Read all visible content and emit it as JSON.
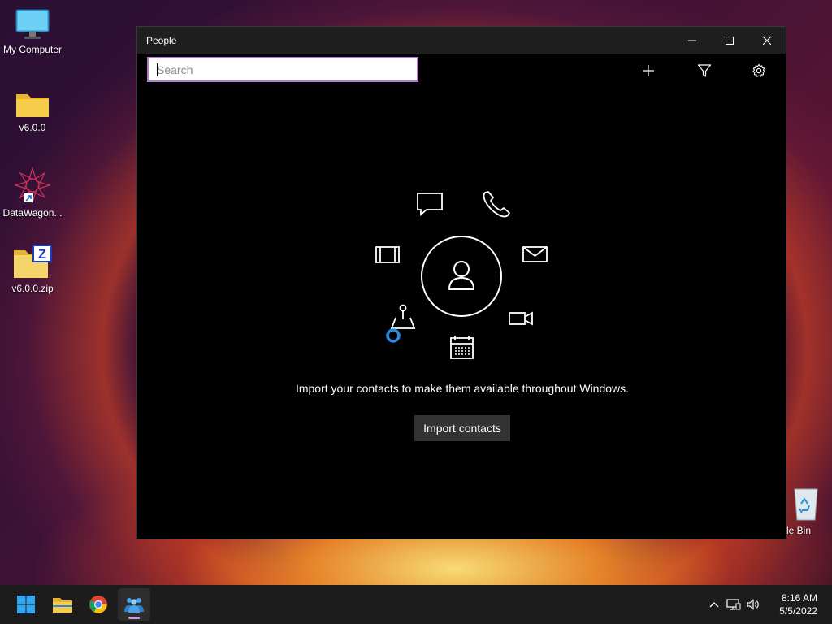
{
  "desktop": {
    "icons": [
      {
        "label": "My Computer"
      },
      {
        "label": "v6.0.0"
      },
      {
        "label": "DataWagon..."
      },
      {
        "label": "v6.0.0.zip"
      },
      {
        "label": "cle Bin"
      }
    ]
  },
  "window": {
    "title": "People",
    "search": {
      "placeholder": "Search",
      "value": ""
    },
    "message": "Import your contacts to make them available throughout Windows.",
    "import_button": "Import contacts"
  },
  "taskbar": {
    "time": "8:16 AM",
    "date": "5/5/2022"
  },
  "colors": {
    "accent": "#b77ac9",
    "taskbar": "#1c1c1c",
    "window_bg": "#000000"
  }
}
